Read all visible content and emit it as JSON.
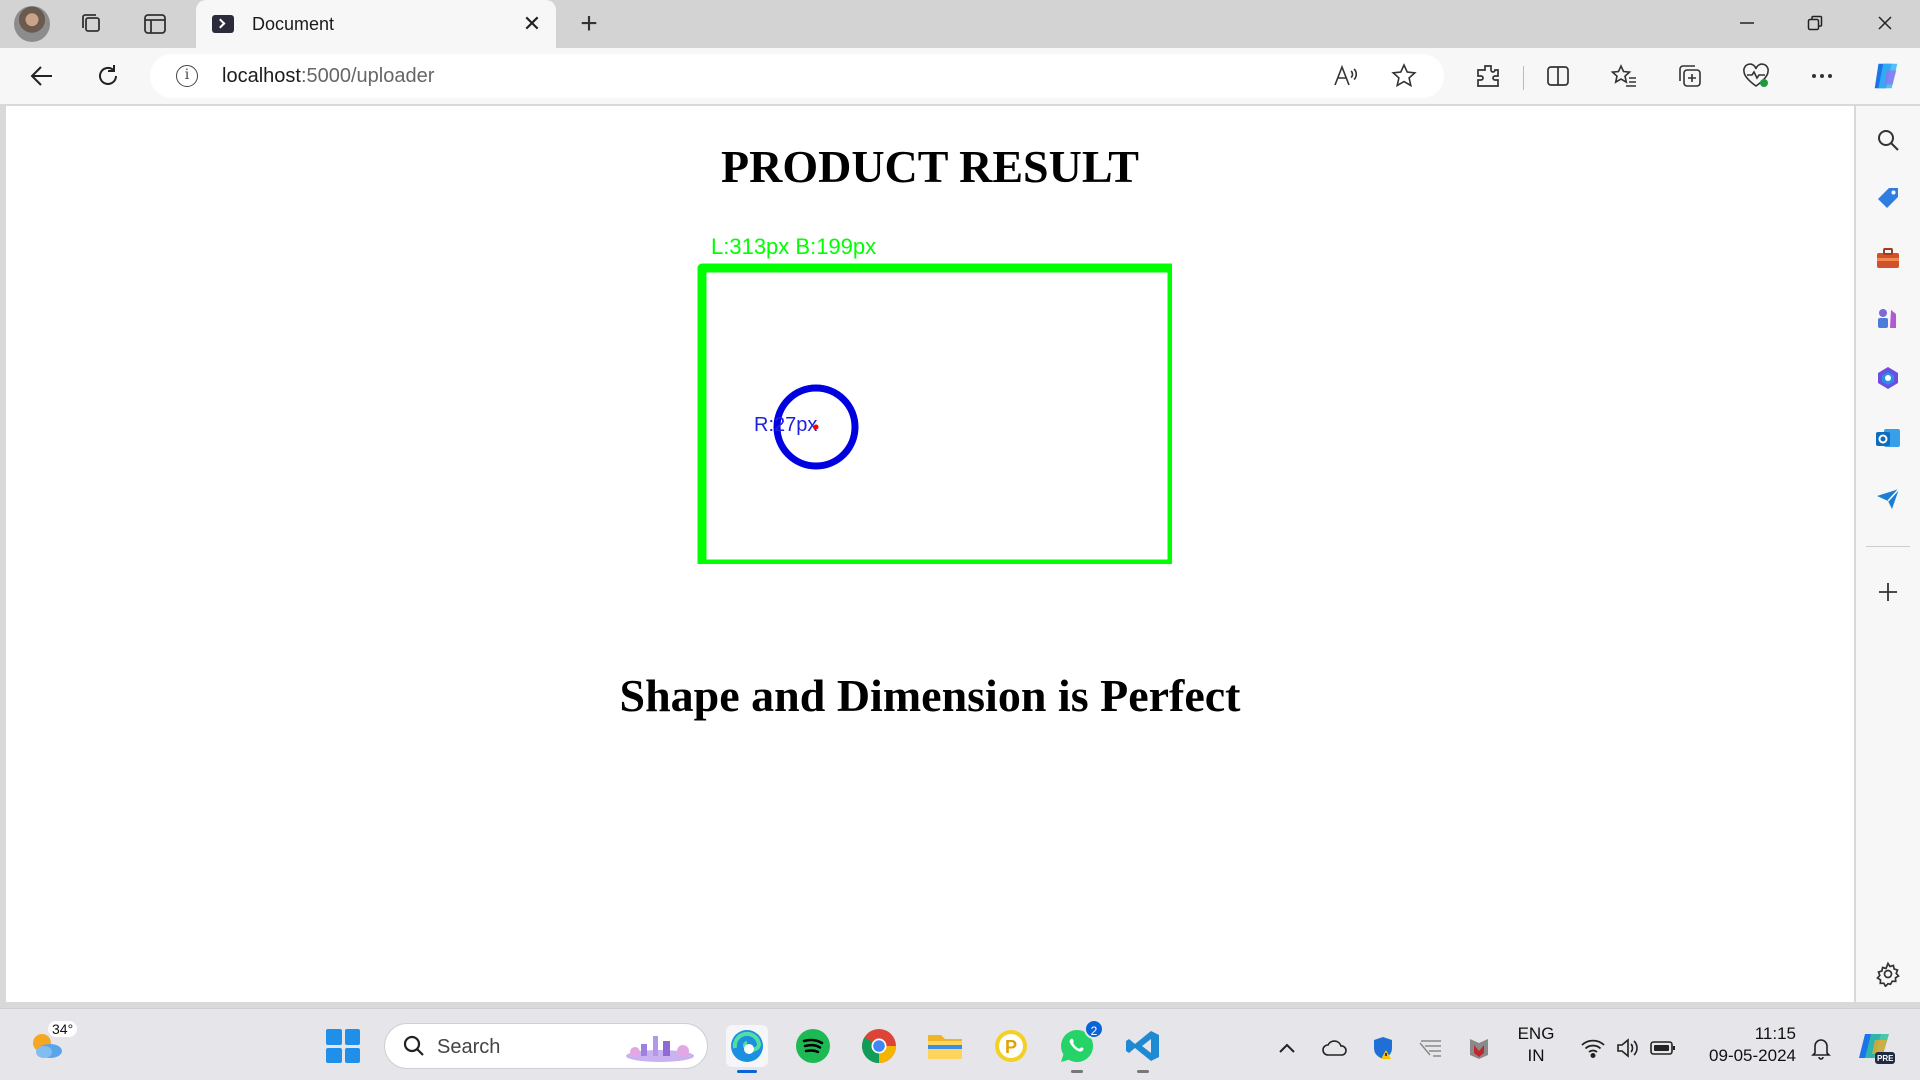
{
  "browser": {
    "tab_title": "Document",
    "url_host": "localhost",
    "url_path": ":5000/uploader"
  },
  "page": {
    "title": "PRODUCT RESULT",
    "message": "Shape and Dimension is Perfect",
    "result_image": {
      "rect_label": "L:313px B:199px",
      "circle_label": "R:27px",
      "colors": {
        "rectangle": "#00ff00",
        "circle": "#0000e0",
        "center_dot": "#ff0000"
      }
    }
  },
  "taskbar": {
    "temperature": "34°",
    "search_label": "Search",
    "whatsapp_badge": "2",
    "language_line1": "ENG",
    "language_line2": "IN",
    "time": "11:15",
    "date": "09-05-2024"
  }
}
